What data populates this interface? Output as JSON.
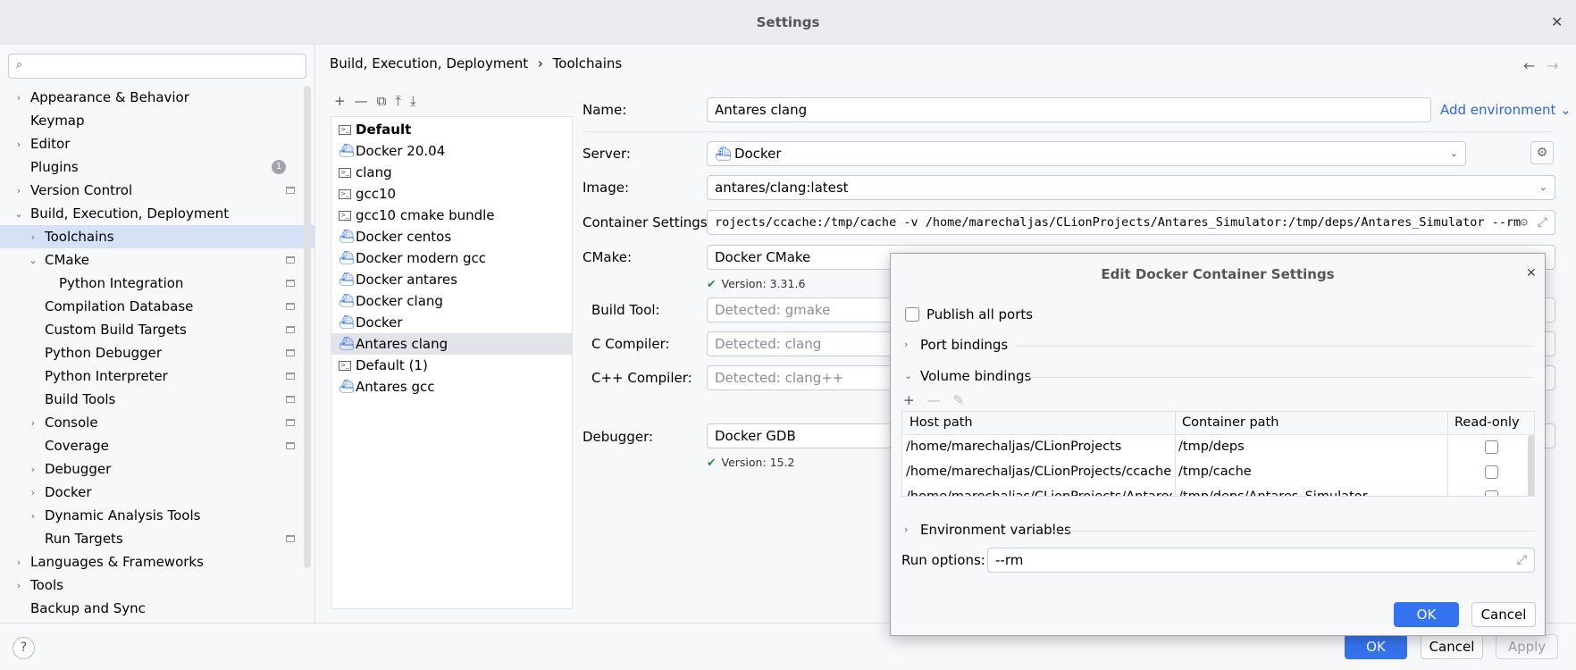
{
  "window": {
    "title": "Settings",
    "close": "✕"
  },
  "search": {
    "placeholder": "",
    "icon": "search-icon"
  },
  "sidebar": {
    "items": [
      {
        "label": "Appearance & Behavior",
        "indent": 0,
        "chev": "›",
        "bold": true
      },
      {
        "label": "Keymap",
        "indent": 0,
        "chev": "",
        "bold": true
      },
      {
        "label": "Editor",
        "indent": 0,
        "chev": "›",
        "bold": true
      },
      {
        "label": "Plugins",
        "indent": 0,
        "chev": "",
        "bold": true,
        "badge": "1"
      },
      {
        "label": "Version Control",
        "indent": 0,
        "chev": "›",
        "bold": true,
        "pin": true
      },
      {
        "label": "Build, Execution, Deployment",
        "indent": 0,
        "chev": "⌄",
        "bold": true
      },
      {
        "label": "Toolchains",
        "indent": 1,
        "chev": "›",
        "selected": true
      },
      {
        "label": "CMake",
        "indent": 1,
        "chev": "⌄",
        "pin": true
      },
      {
        "label": "Python Integration",
        "indent": 2,
        "chev": "",
        "pin": true
      },
      {
        "label": "Compilation Database",
        "indent": 1,
        "chev": "",
        "pin": true
      },
      {
        "label": "Custom Build Targets",
        "indent": 1,
        "chev": "",
        "pin": true
      },
      {
        "label": "Python Debugger",
        "indent": 1,
        "chev": "",
        "pin": true
      },
      {
        "label": "Python Interpreter",
        "indent": 1,
        "chev": "",
        "pin": true
      },
      {
        "label": "Build Tools",
        "indent": 1,
        "chev": "",
        "pin": true
      },
      {
        "label": "Console",
        "indent": 1,
        "chev": "›",
        "pin": true
      },
      {
        "label": "Coverage",
        "indent": 1,
        "chev": "",
        "pin": true
      },
      {
        "label": "Debugger",
        "indent": 1,
        "chev": "›"
      },
      {
        "label": "Docker",
        "indent": 1,
        "chev": "›"
      },
      {
        "label": "Dynamic Analysis Tools",
        "indent": 1,
        "chev": "›"
      },
      {
        "label": "Run Targets",
        "indent": 1,
        "chev": "",
        "pin": true
      },
      {
        "label": "Languages & Frameworks",
        "indent": 0,
        "chev": "›",
        "bold": true
      },
      {
        "label": "Tools",
        "indent": 0,
        "chev": "›",
        "bold": true
      },
      {
        "label": "Backup and Sync",
        "indent": 0,
        "chev": "",
        "bold": true
      }
    ]
  },
  "breadcrumb": {
    "parent": "Build, Execution, Deployment",
    "sep": "›",
    "current": "Toolchains",
    "back": "←",
    "forward": "→"
  },
  "toolchain_toolbar": {
    "add": "+",
    "remove": "—",
    "copy": "⧉",
    "up": "⤒",
    "down": "⤓"
  },
  "toolchains": [
    {
      "name": "Default",
      "icon": "terminal",
      "bold": true
    },
    {
      "name": "Docker 20.04",
      "icon": "docker"
    },
    {
      "name": "clang",
      "icon": "terminal"
    },
    {
      "name": "gcc10",
      "icon": "terminal"
    },
    {
      "name": "gcc10 cmake bundle",
      "icon": "terminal"
    },
    {
      "name": "Docker centos",
      "icon": "docker"
    },
    {
      "name": "Docker modern gcc",
      "icon": "docker"
    },
    {
      "name": "Docker antares",
      "icon": "docker"
    },
    {
      "name": "Docker clang",
      "icon": "docker"
    },
    {
      "name": "Docker",
      "icon": "docker"
    },
    {
      "name": "Antares clang",
      "icon": "docker",
      "selected": true
    },
    {
      "name": "Default (1)",
      "icon": "terminal"
    },
    {
      "name": "Antares gcc",
      "icon": "docker"
    }
  ],
  "form": {
    "name_label": "Name:",
    "name_value": "Antares clang",
    "add_environment": "Add environment ⌄",
    "server_label": "Server:",
    "server_value": "Docker",
    "image_label": "Image:",
    "image_value": "antares/clang:latest",
    "container_label": "Container Settings:",
    "container_value": "rojects/ccache:/tmp/cache -v /home/marechaljas/CLionProjects/Antares_Simulator:/tmp/deps/Antares_Simulator --rm",
    "cmake_label": "CMake:",
    "cmake_value": "Docker CMake",
    "cmake_version": "Version: 3.31.6",
    "buildtool_label": "Build Tool:",
    "buildtool_placeholder": "Detected: gmake",
    "c_label": "C Compiler:",
    "c_placeholder": "Detected: clang",
    "cpp_label": "C++ Compiler:",
    "cpp_placeholder": "Detected: clang++",
    "debugger_label": "Debugger:",
    "debugger_value": "Docker GDB",
    "debugger_version": "Version: 15.2",
    "check": "✔"
  },
  "footer": {
    "ok": "OK",
    "cancel": "Cancel",
    "apply": "Apply",
    "help": "?"
  },
  "dialog": {
    "title": "Edit Docker Container Settings",
    "close": "✕",
    "publish_all_ports": "Publish all ports",
    "port_bindings": "Port bindings",
    "volume_bindings": "Volume bindings",
    "toolbar": {
      "add": "+",
      "remove": "—",
      "edit": "✎"
    },
    "columns": [
      "Host path",
      "Container path",
      "Read-only"
    ],
    "rows": [
      {
        "host": "/home/marechaljas/CLionProjects",
        "container": "/tmp/deps"
      },
      {
        "host": "/home/marechaljas/CLionProjects/ccache",
        "container": "/tmp/cache"
      },
      {
        "host": "/home/marechaljas/CLionProjects/Antares_...",
        "container": "/tmp/deps/Antares_Simulator"
      }
    ],
    "environment_variables": "Environment variables",
    "run_options_label": "Run options:",
    "run_options_value": "--rm",
    "ok": "OK",
    "cancel": "Cancel"
  },
  "colors": {
    "accent": "#3574f0",
    "selection": "#d5e1f7",
    "link": "#3166d6",
    "ok_check": "#2b8a3e"
  }
}
